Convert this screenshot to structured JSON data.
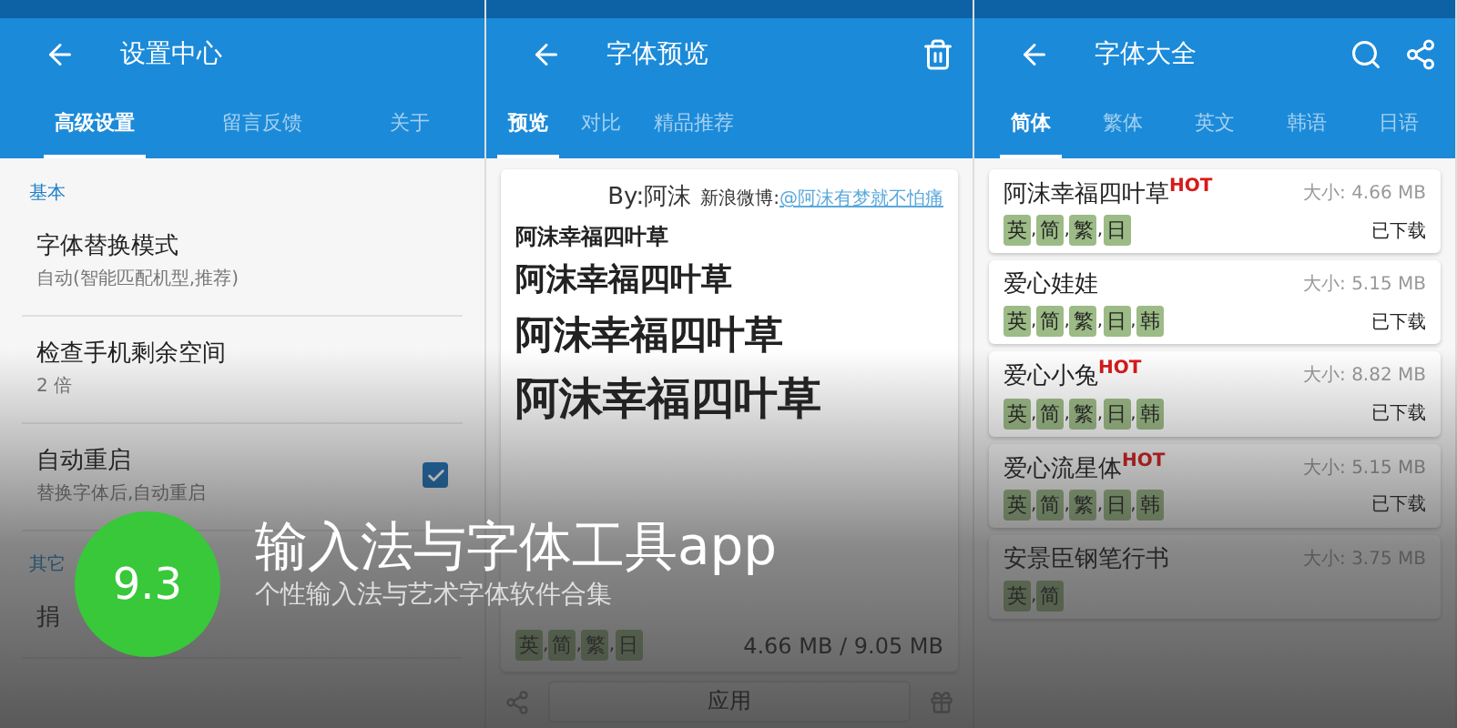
{
  "separator": ",",
  "rating": "9.3",
  "headline": "输入法与字体工具app",
  "tagline": "个性输入法与艺术字体软件合集",
  "screens": [
    {
      "kind": "settings",
      "title": "设置中心",
      "tabs": [
        {
          "label": "高级设置",
          "selected": true
        },
        {
          "label": "留言反馈",
          "selected": false
        },
        {
          "label": "关于",
          "selected": false
        }
      ],
      "sections": [
        {
          "heading": "基本",
          "items": [
            {
              "label": "字体替换模式",
              "detail": "自动(智能匹配机型,推荐)"
            },
            {
              "label": "检查手机剩余空间",
              "detail": "2 倍"
            },
            {
              "label": "自动重启",
              "detail": "替换字体后,自动重启",
              "checked": true
            }
          ]
        },
        {
          "heading": "其它",
          "items": [
            {
              "label": "捐"
            }
          ]
        }
      ]
    },
    {
      "kind": "preview",
      "title": "字体预览",
      "tabs": [
        {
          "label": "预览",
          "selected": true
        },
        {
          "label": "对比",
          "selected": false
        },
        {
          "label": "精品推荐",
          "selected": false
        }
      ],
      "author": "By:阿沫",
      "weibo_label": "新浪微博:",
      "weibo_link": "@阿沫有梦就不怕痛",
      "samples": [
        "阿沫幸福四叶草",
        "阿沫幸福四叶草",
        "阿沫幸福四叶草",
        "阿沫幸福四叶草"
      ],
      "tags": [
        "英",
        "简",
        "繁",
        "日"
      ],
      "size": "4.66 MB / 9.05 MB",
      "apply_button": "应用"
    },
    {
      "kind": "catalog",
      "title": "字体大全",
      "tabs": [
        {
          "label": "简体",
          "selected": true
        },
        {
          "label": "繁体",
          "selected": false
        },
        {
          "label": "英文",
          "selected": false
        },
        {
          "label": "韩语",
          "selected": false
        },
        {
          "label": "日语",
          "selected": false
        }
      ],
      "fonts": [
        {
          "name": "阿沫幸福四叶草",
          "badge": "HOT",
          "size": "大小: 4.66 MB",
          "tags": [
            "英",
            "简",
            "繁",
            "日"
          ],
          "status": "已下载"
        },
        {
          "name": "爱心娃娃",
          "size": "大小: 5.15 MB",
          "tags": [
            "英",
            "简",
            "繁",
            "日",
            "韩"
          ],
          "status": "已下载"
        },
        {
          "name": "爱心小兔",
          "badge": "HOT",
          "size": "大小: 8.82 MB",
          "tags": [
            "英",
            "简",
            "繁",
            "日",
            "韩"
          ],
          "status": "已下载"
        },
        {
          "name": "爱心流星体",
          "badge": "HOT",
          "size": "大小: 5.15 MB",
          "tags": [
            "英",
            "简",
            "繁",
            "日",
            "韩"
          ],
          "status": "已下载"
        },
        {
          "name": "安景臣钢笔行书",
          "size": "大小: 3.75 MB",
          "tags": [
            "英",
            "简"
          ]
        }
      ]
    }
  ]
}
